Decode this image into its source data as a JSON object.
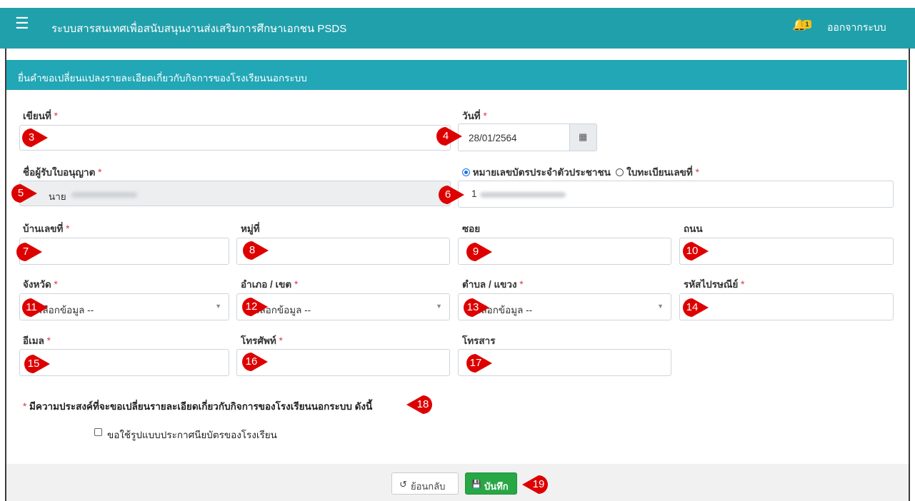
{
  "header": {
    "menu_icon": "☰",
    "title": "ระบบสารสนเทศเพื่อสนับสนุนงานส่งเสริมการศึกษาเอกชน PSDS",
    "bell_icon": "🔔",
    "notification_count": "1",
    "logout_label": "ออกจากระบบ"
  },
  "panel": {
    "title": "ยื่นคำขอเปลี่ยนแปลงรายละเอียดเกี่ยวกับกิจการของโรงเรียนนอกระบบ"
  },
  "form": {
    "written_at": {
      "label": "เขียนที่",
      "value": ""
    },
    "date": {
      "label": "วันที่",
      "value": "28/01/2564"
    },
    "licensee_name": {
      "label": "ชื่อผู้รับใบอนุญาต",
      "value_prefix": "นาย"
    },
    "id_type": {
      "option_id_card": "หมายเลขบัตรประจำตัวประชาชน",
      "option_registration": "ใบทะเบียนเลขที่",
      "selected": "หมายเลขบัตรประจำตัวประชาชน",
      "value_prefix": "1"
    },
    "house_no": {
      "label": "บ้านเลขที่",
      "value": ""
    },
    "moo": {
      "label": "หมู่ที่",
      "value": ""
    },
    "soi": {
      "label": "ซอย",
      "value": ""
    },
    "road": {
      "label": "ถนน",
      "value": ""
    },
    "province": {
      "label": "จังหวัด",
      "value": "-- เลือกข้อมูล --"
    },
    "district": {
      "label": "อำเภอ / เขต",
      "value": "-- เลือกข้อมูล --"
    },
    "subdistrict": {
      "label": "ตำบล / แขวง",
      "value": "-- เลือกข้อมูล --"
    },
    "postcode": {
      "label": "รหัสไปรษณีย์",
      "value": ""
    },
    "email": {
      "label": "อีเมล",
      "value": ""
    },
    "phone": {
      "label": "โทรศัพท์",
      "value": ""
    },
    "fax": {
      "label": "โทรสาร",
      "value": ""
    },
    "required_mark": "*"
  },
  "purpose": {
    "label": "มีความประสงค์ที่จะขอเปลี่ยนรายละเอียดเกี่ยวกับกิจการของโรงเรียนนอกระบบ ดังนี้",
    "option_1": "ขอใช้รูปแบบประกาศนียบัตรของโรงเรียน"
  },
  "buttons": {
    "back_label": "ย้อนกลับ",
    "save_label": "บันทึก",
    "back_icon": "↺",
    "save_icon": "💾"
  },
  "markers": [
    "3",
    "4",
    "5",
    "6",
    "7",
    "8",
    "9",
    "10",
    "11",
    "12",
    "13",
    "14",
    "15",
    "16",
    "17",
    "18",
    "19"
  ],
  "colors": {
    "header": "#20a0ab",
    "panel_header": "#21a7b6",
    "marker": "#dd0000",
    "save": "#28a745",
    "required": "#dc3545"
  }
}
